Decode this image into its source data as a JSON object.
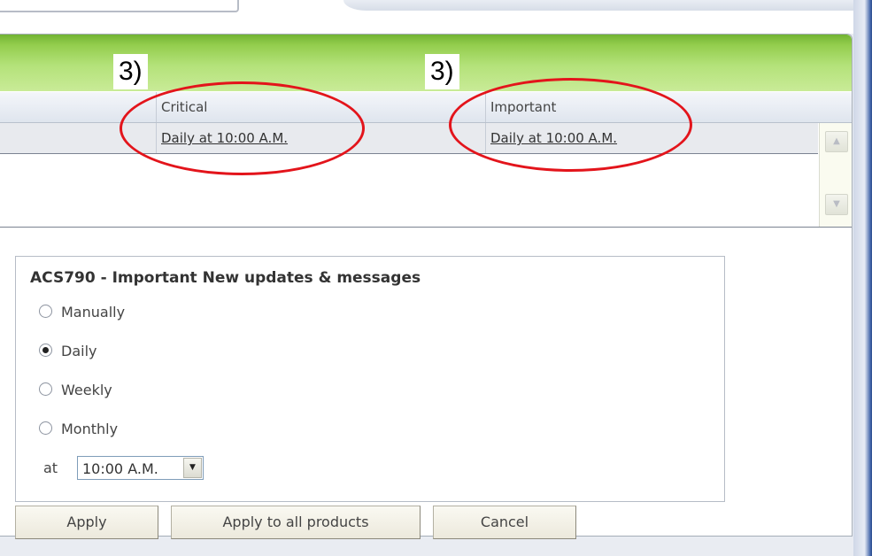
{
  "annotations": {
    "left_label": "3)",
    "right_label": "3)"
  },
  "table": {
    "columns": {
      "critical": "Critical",
      "important": "Important"
    },
    "row": {
      "critical_schedule": "Daily at 10:00 A.M.",
      "important_schedule": "Daily at 10:00 A.M."
    }
  },
  "settings": {
    "title": "ACS790 - Important New updates & messages",
    "options": [
      "Manually",
      "Daily",
      "Weekly",
      "Monthly"
    ],
    "selected": "Daily",
    "at_label": "at",
    "time_value": "10:00 A.M."
  },
  "buttons": {
    "apply": "Apply",
    "apply_all": "Apply to all products",
    "cancel": "Cancel"
  },
  "colors": {
    "header_green": "#93cd4d",
    "annotation_red": "#e3141b"
  }
}
